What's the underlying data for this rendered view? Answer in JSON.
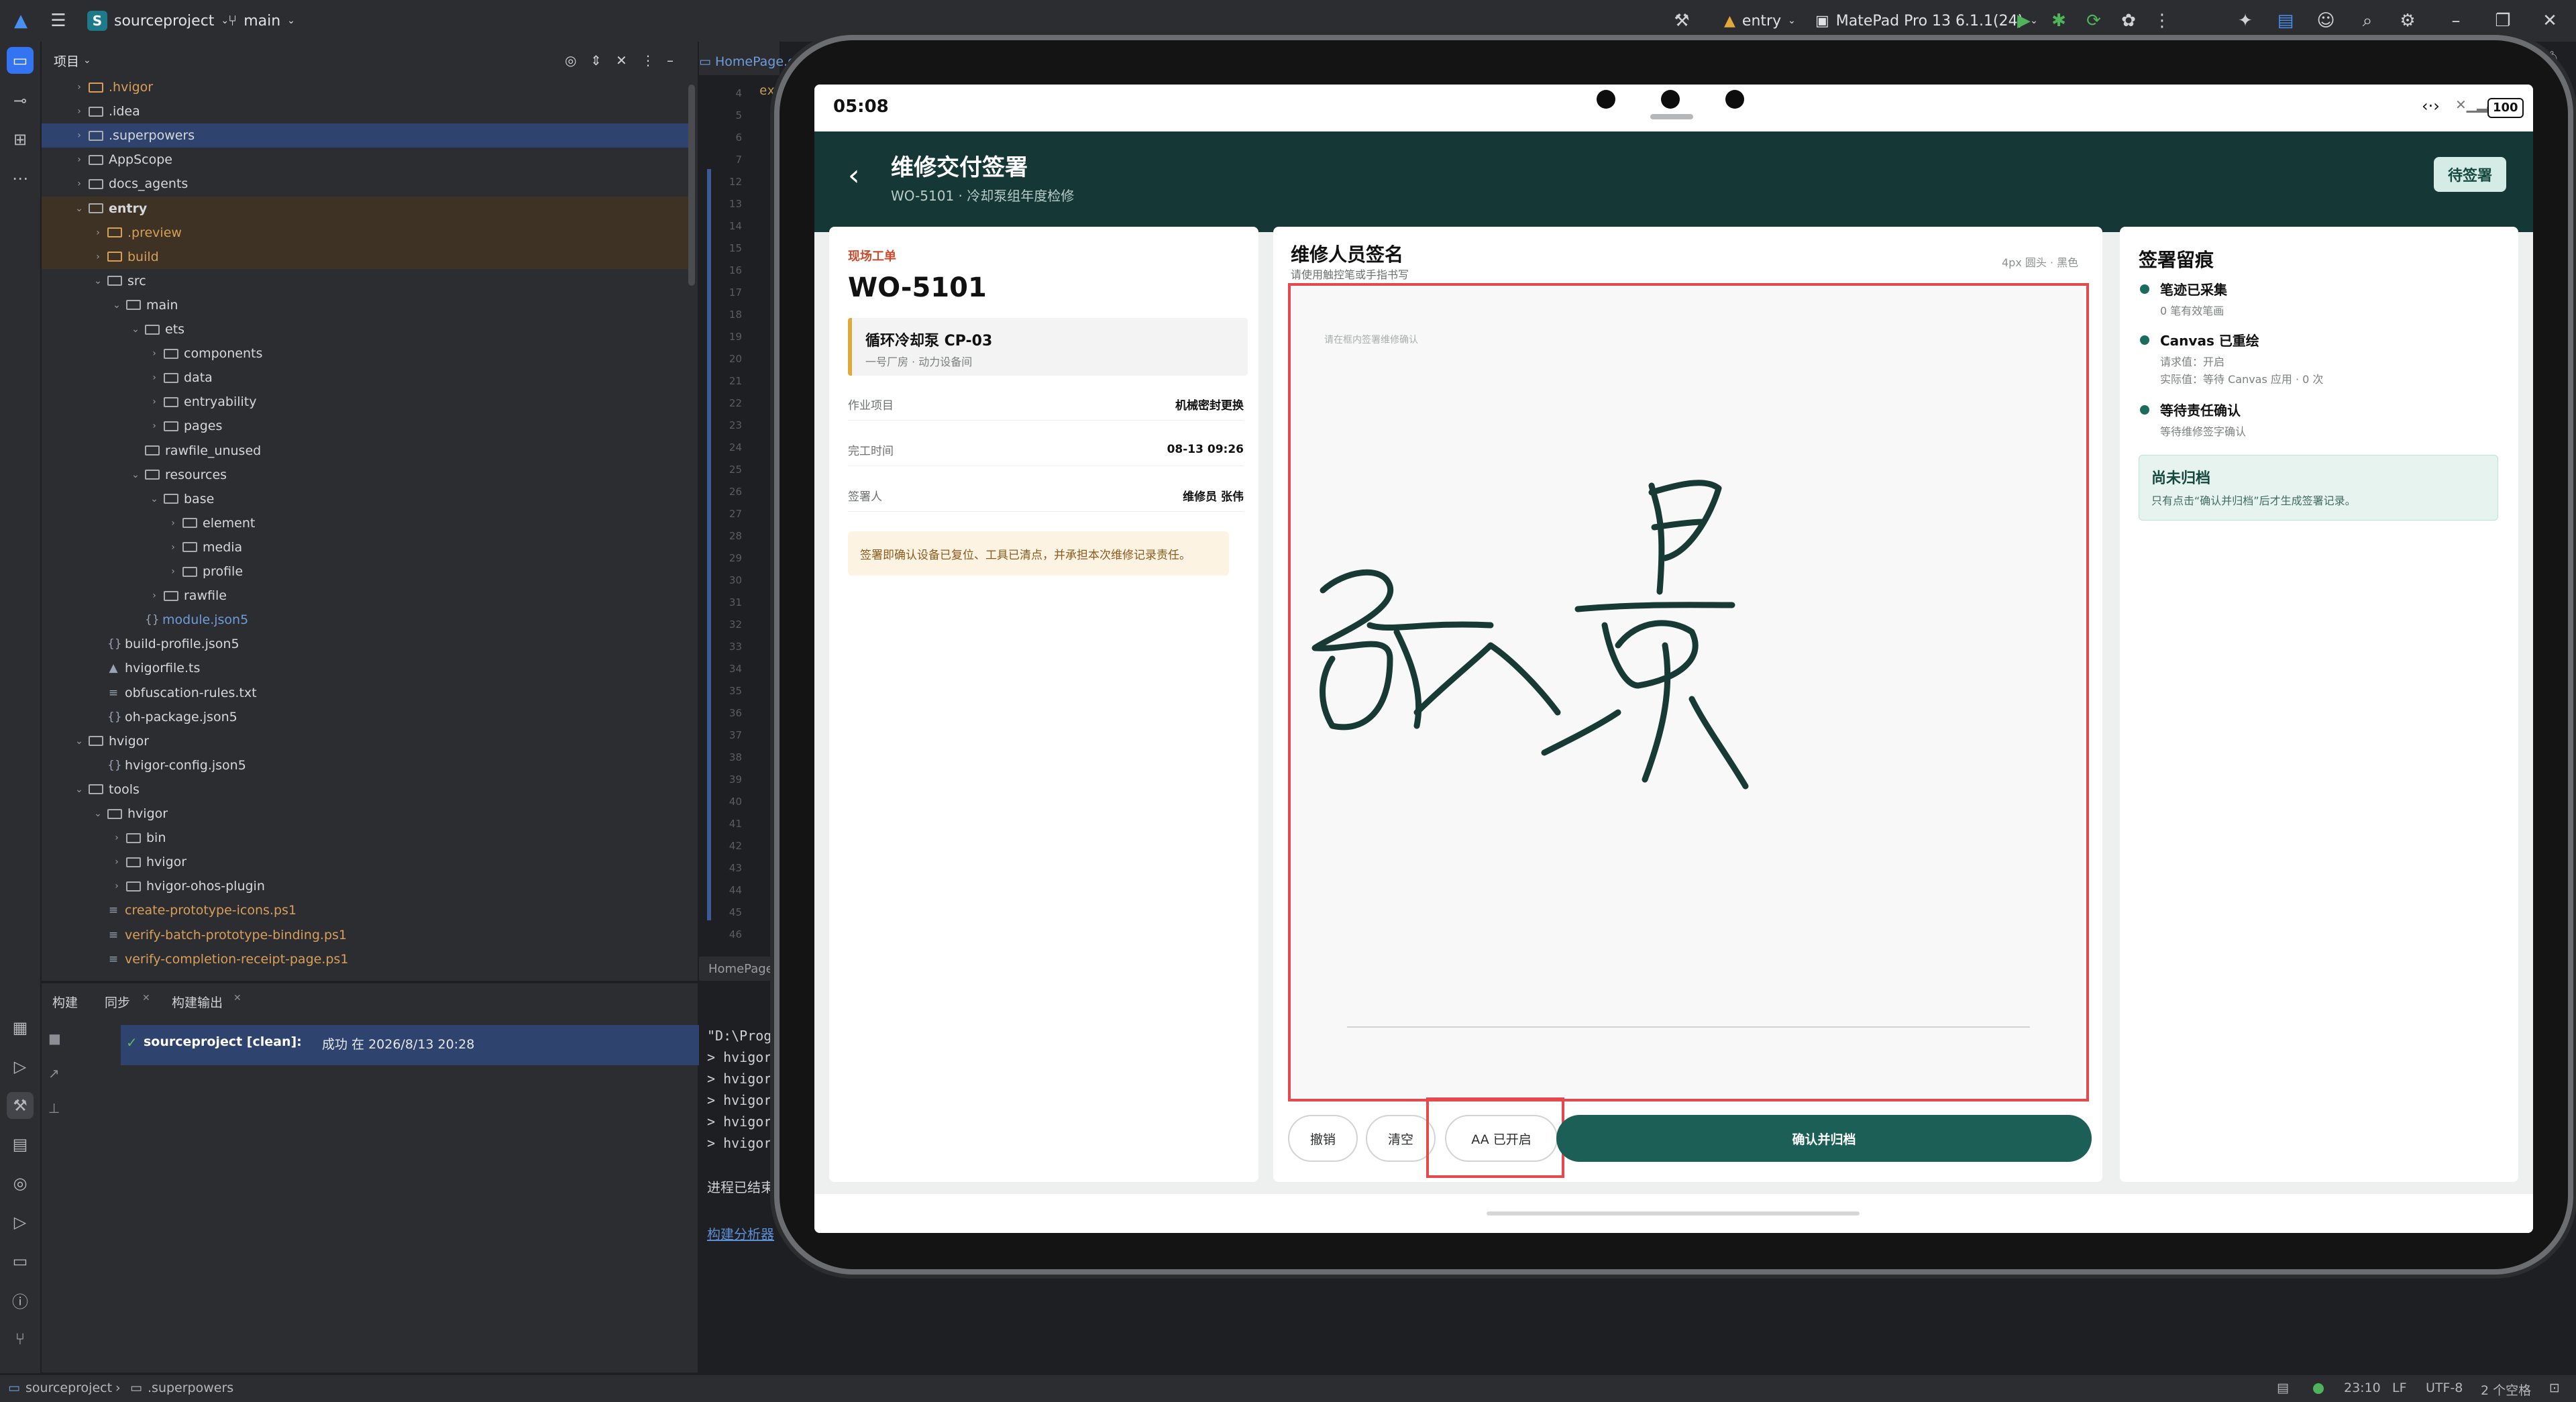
{
  "ide": {
    "project_name": "sourceproject",
    "project_badge": "S",
    "branch": "main",
    "run_config": "entry",
    "device": "MatePad Pro 13 6.1.1(24)",
    "panel_title": "项目",
    "editor_tab": "HomePage.e",
    "editor_bottom_tab": "HomePage",
    "code_snippet": "ex"
  },
  "tree": [
    {
      "label": ".hvigor",
      "depth": 1,
      "kind": "folder",
      "style": "orange",
      "state": "collapsed"
    },
    {
      "label": ".idea",
      "depth": 1,
      "kind": "folder",
      "state": "collapsed"
    },
    {
      "label": ".superpowers",
      "depth": 1,
      "kind": "folder",
      "state": "collapsed",
      "selected": true
    },
    {
      "label": "AppScope",
      "depth": 1,
      "kind": "folder",
      "state": "collapsed"
    },
    {
      "label": "docs_agents",
      "depth": 1,
      "kind": "folder",
      "state": "collapsed"
    },
    {
      "label": "entry",
      "depth": 1,
      "kind": "folder",
      "state": "expanded",
      "bold": true,
      "excluded": true
    },
    {
      "label": ".preview",
      "depth": 2,
      "kind": "folder",
      "style": "orange",
      "state": "collapsed",
      "excluded": true
    },
    {
      "label": "build",
      "depth": 2,
      "kind": "folder",
      "style": "orange",
      "state": "collapsed",
      "excluded": true
    },
    {
      "label": "src",
      "depth": 2,
      "kind": "folder",
      "state": "expanded"
    },
    {
      "label": "main",
      "depth": 3,
      "kind": "folder",
      "state": "expanded"
    },
    {
      "label": "ets",
      "depth": 4,
      "kind": "folder",
      "state": "expanded"
    },
    {
      "label": "components",
      "depth": 5,
      "kind": "folder",
      "state": "collapsed"
    },
    {
      "label": "data",
      "depth": 5,
      "kind": "folder",
      "state": "collapsed"
    },
    {
      "label": "entryability",
      "depth": 5,
      "kind": "folder",
      "state": "collapsed"
    },
    {
      "label": "pages",
      "depth": 5,
      "kind": "folder",
      "state": "collapsed"
    },
    {
      "label": "rawfile_unused",
      "depth": 4,
      "kind": "folder",
      "state": "none"
    },
    {
      "label": "resources",
      "depth": 4,
      "kind": "folder",
      "state": "expanded"
    },
    {
      "label": "base",
      "depth": 5,
      "kind": "folder",
      "state": "expanded"
    },
    {
      "label": "element",
      "depth": 6,
      "kind": "folder",
      "state": "collapsed"
    },
    {
      "label": "media",
      "depth": 6,
      "kind": "folder",
      "state": "collapsed"
    },
    {
      "label": "profile",
      "depth": 6,
      "kind": "folder",
      "state": "collapsed"
    },
    {
      "label": "rawfile",
      "depth": 5,
      "kind": "folder",
      "state": "collapsed"
    },
    {
      "label": "module.json5",
      "depth": 4,
      "kind": "json",
      "style": "blue",
      "state": "none"
    },
    {
      "label": "build-profile.json5",
      "depth": 2,
      "kind": "json",
      "state": "none"
    },
    {
      "label": "hvigorfile.ts",
      "depth": 2,
      "kind": "ts",
      "state": "none"
    },
    {
      "label": "obfuscation-rules.txt",
      "depth": 2,
      "kind": "txt",
      "state": "none"
    },
    {
      "label": "oh-package.json5",
      "depth": 2,
      "kind": "json",
      "state": "none"
    },
    {
      "label": "hvigor",
      "depth": 1,
      "kind": "folder",
      "state": "expanded"
    },
    {
      "label": "hvigor-config.json5",
      "depth": 2,
      "kind": "json",
      "state": "none"
    },
    {
      "label": "tools",
      "depth": 1,
      "kind": "folder",
      "state": "expanded"
    },
    {
      "label": "hvigor",
      "depth": 2,
      "kind": "folder",
      "state": "expanded"
    },
    {
      "label": "bin",
      "depth": 3,
      "kind": "folder",
      "state": "collapsed"
    },
    {
      "label": "hvigor",
      "depth": 3,
      "kind": "folder",
      "state": "collapsed"
    },
    {
      "label": "hvigor-ohos-plugin",
      "depth": 3,
      "kind": "folder",
      "state": "collapsed"
    },
    {
      "label": "create-prototype-icons.ps1",
      "depth": 2,
      "kind": "txt",
      "style": "orange",
      "state": "none"
    },
    {
      "label": "verify-batch-prototype-binding.ps1",
      "depth": 2,
      "kind": "txt",
      "style": "orange",
      "state": "none"
    },
    {
      "label": "verify-completion-receipt-page.ps1",
      "depth": 2,
      "kind": "txt",
      "style": "orange",
      "state": "none"
    }
  ],
  "gutter_lines": [
    "4",
    "5",
    "6",
    "7",
    "12",
    "13",
    "14",
    "15",
    "16",
    "17",
    "18",
    "19",
    "20",
    "21",
    "22",
    "23",
    "24",
    "25",
    "26",
    "27",
    "28",
    "29",
    "30",
    "31",
    "32",
    "33",
    "34",
    "35",
    "36",
    "37",
    "38",
    "39",
    "40",
    "41",
    "42",
    "43",
    "44",
    "45",
    "46"
  ],
  "bottom": {
    "tabs": [
      "构建",
      "同步",
      "构建输出"
    ],
    "build_entry_title": "sourceproject [clean]:",
    "build_entry_status": "成功 在 2026/8/13 20:28",
    "console_lines": [
      "\"D:\\Progr",
      "> hvigor",
      "> hvigor",
      "> hvigor",
      "> hvigor",
      "> hvigor"
    ],
    "console_finished": "进程已结束,",
    "console_link": "构建分析器"
  },
  "statusbar": {
    "breadcrumb_root": "sourceproject",
    "breadcrumb_leaf": ".superpowers",
    "position": "23:10",
    "line_sep": "LF",
    "encoding": "UTF-8",
    "indent": "2 个空格"
  },
  "device": {
    "time": "05:08",
    "battery": "100",
    "header_title": "维修交付签署",
    "header_subtitle": "WO-5101 · 冷却泵组年度检修",
    "status_button": "待签署",
    "order": {
      "tag": "现场工单",
      "number": "WO-5101",
      "equipment_name": "循环冷却泵 CP-03",
      "equipment_location": "一号厂房 · 动力设备间",
      "rows": [
        {
          "key": "作业项目",
          "value": "机械密封更换"
        },
        {
          "key": "完工时间",
          "value": "08-13 09:26"
        },
        {
          "key": "签署人",
          "value": "维修员 张伟"
        }
      ],
      "notice": "签署即确认设备已复位、工具已清点，并承担本次维修记录责任。"
    },
    "signature": {
      "title": "维修人员签名",
      "subtitle": "请使用触控笔或手指书写",
      "brush_info": "4px 圆头 · 黑色",
      "hint": "请在框内签署维修确认",
      "ink_color": "#173b34"
    },
    "actions": {
      "undo": "撤销",
      "clear": "清空",
      "antialias": "AA 已开启",
      "confirm": "确认并归档"
    },
    "record": {
      "title": "签署留痕",
      "items": [
        {
          "title": "笔迹已采集",
          "lines": [
            "0 笔有效笔画"
          ]
        },
        {
          "title": "Canvas 已重绘",
          "lines": [
            "请求值：开启",
            "实际值：等待 Canvas 应用 · 0 次"
          ]
        },
        {
          "title": "等待责任确认",
          "lines": [
            "等待维修签字确认"
          ]
        }
      ],
      "status_title": "尚未归档",
      "status_text": "只有点击“确认并归档”后才生成签署记录。"
    }
  },
  "colors": {
    "accent": "#1b5f57",
    "header_bg": "#153836",
    "tag_red": "#c84a2c",
    "highlight_red": "#e5484d",
    "notice_bg": "#fdf3e2"
  }
}
